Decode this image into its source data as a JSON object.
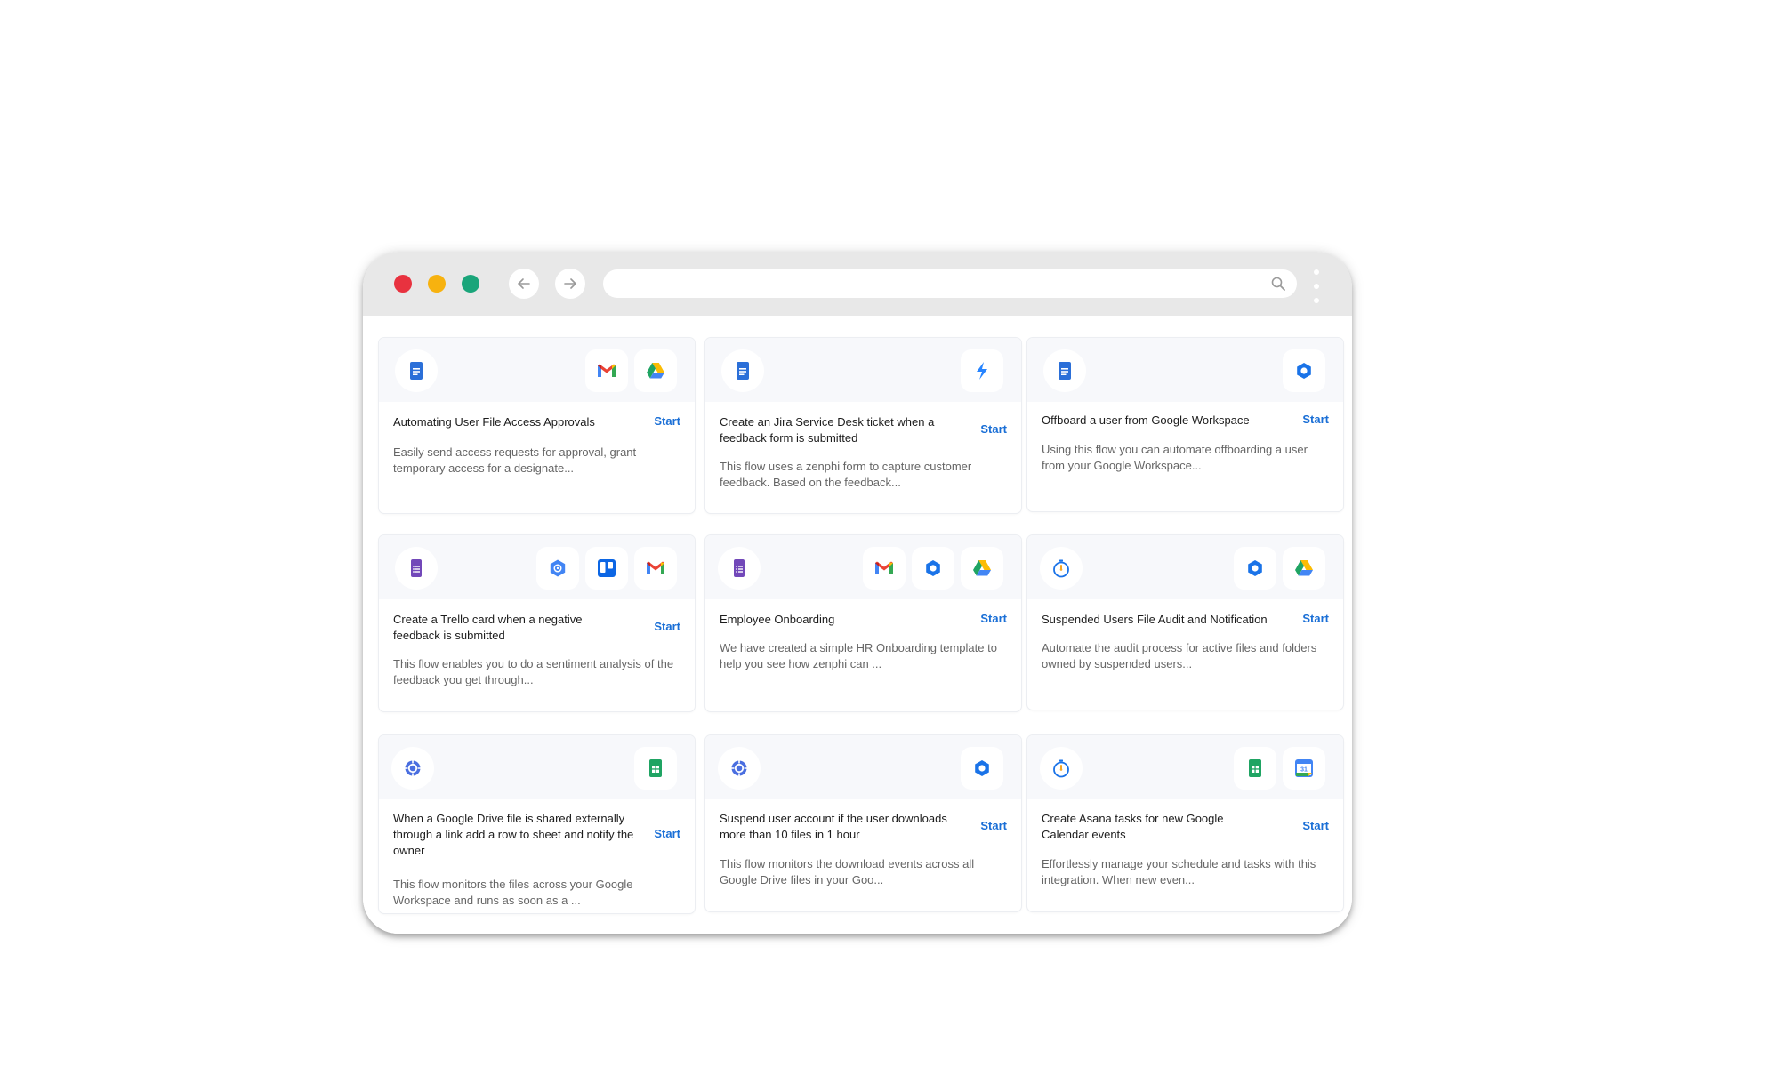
{
  "browser": {
    "address_value": "",
    "address_placeholder": ""
  },
  "cards": [
    {
      "title": "Automating User File Access Approvals",
      "start": "Start",
      "description": "Easily send access requests for approval, grant temporary access for a designate...",
      "source_icon": "google-docs-icon",
      "app_icons": [
        "gmail-icon",
        "google-drive-icon"
      ]
    },
    {
      "title": "Create an Jira Service Desk ticket when a feedback form is submitted",
      "start": "Start",
      "description": "This flow uses a zenphi form to capture customer feedback. Based on the feedback...",
      "source_icon": "google-docs-icon",
      "app_icons": [
        "jira-service-desk-icon"
      ]
    },
    {
      "title": "Offboard a user from Google Workspace",
      "start": "Start",
      "description": "Using this flow you can automate offboarding a user from your Google Workspace...",
      "source_icon": "google-docs-icon",
      "app_icons": [
        "google-admin-icon"
      ]
    },
    {
      "title": "Create a Trello card when a negative feedback is submitted",
      "start": "Start",
      "description": "This flow enables you to do a sentiment analysis of the feedback you get through...",
      "source_icon": "google-forms-icon",
      "app_icons": [
        "google-cloud-nlp-icon",
        "trello-icon",
        "gmail-icon"
      ]
    },
    {
      "title": "Employee Onboarding",
      "start": "Start",
      "description": "We have created a simple HR Onboarding template to help you see how zenphi can ...",
      "source_icon": "google-forms-icon",
      "app_icons": [
        "gmail-icon",
        "google-admin-icon",
        "google-drive-icon"
      ]
    },
    {
      "title": "Suspended Users File Audit and Notification",
      "start": "Start",
      "description": "Automate the audit process for active files and folders owned by suspended users...",
      "source_icon": "timer-icon",
      "app_icons": [
        "google-admin-icon",
        "google-drive-icon"
      ]
    },
    {
      "title": "When a Google Drive file is shared externally through a link add a row to sheet and notify the owner",
      "start": "Start",
      "description": "This flow monitors the files across your Google Workspace and runs as soon as a ...",
      "source_icon": "workspace-event-icon",
      "app_icons": [
        "google-sheets-icon"
      ]
    },
    {
      "title": "Suspend user account if the user downloads more than 10 files in 1 hour",
      "start": "Start",
      "description": "This flow monitors the download events across all Google Drive files in your Goo...",
      "source_icon": "workspace-event-icon",
      "app_icons": [
        "google-admin-icon"
      ]
    },
    {
      "title": "Create Asana tasks for new Google Calendar events",
      "start": "Start",
      "description": "Effortlessly manage your schedule and tasks with this integration. When new even...",
      "source_icon": "timer-icon",
      "app_icons": [
        "google-sheets-icon",
        "google-calendar-icon"
      ]
    }
  ]
}
